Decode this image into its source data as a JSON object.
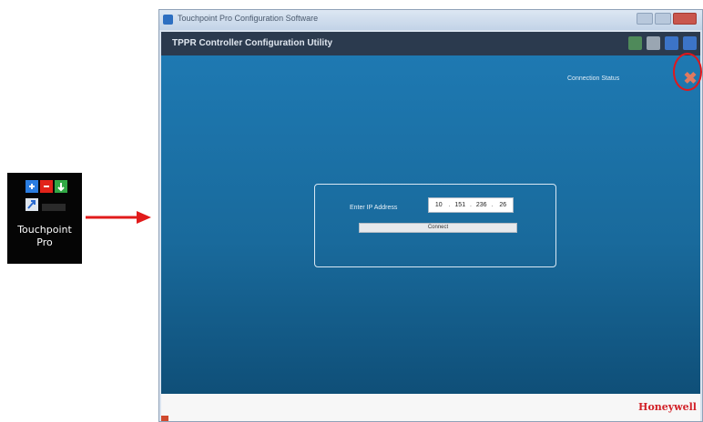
{
  "desktop_shortcut": {
    "label_line1": "Touchpoint",
    "label_line2": "Pro",
    "icon": "touchpoint-pro-icon"
  },
  "window": {
    "title": "Touchpoint Pro Configuration Software"
  },
  "app": {
    "title": "TPPR Controller Configuration Utility",
    "header_icons": [
      "monitor-icon",
      "document-icon",
      "help-icon",
      "info-icon"
    ]
  },
  "status": {
    "text": "Connection Status",
    "icon": "disconnected-x-icon"
  },
  "connect": {
    "ip_label": "Enter IP Address",
    "ip_octets": [
      "10",
      "151",
      "236",
      "26"
    ],
    "button_label": "Connect"
  },
  "footer": {
    "brand": "Honeywell"
  },
  "colors": {
    "brand_red": "#d22128",
    "highlight": "#e2171b",
    "content_blue": "#1e79b2"
  }
}
